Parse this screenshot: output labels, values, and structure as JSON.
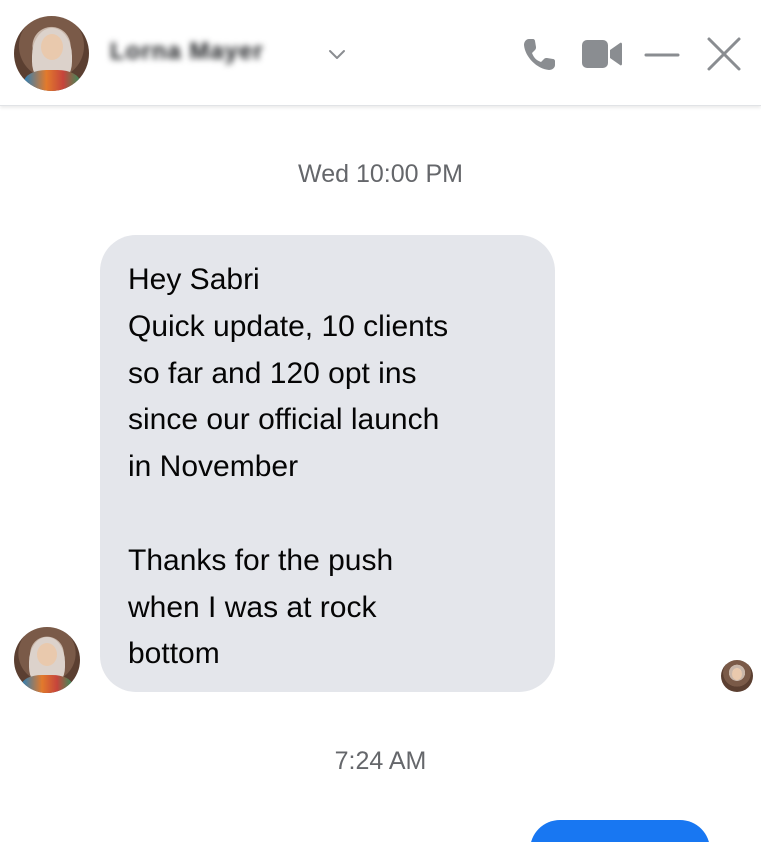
{
  "header": {
    "contact_name": "Lorna Mayer",
    "icons": [
      "phone-icon",
      "video-camera-icon",
      "minimize-icon",
      "close-icon",
      "chevron-down-icon"
    ]
  },
  "messages": {
    "timestamp_1": "Wed 10:00 PM",
    "incoming_text": "Hey Sabri\nQuick update, 10 clients\nso far and 120 opt ins\nsince our official launch\nin November\n\nThanks for the push\nwhen I was at rock\nbottom",
    "timestamp_2": "7:24 AM"
  },
  "colors": {
    "incoming_bubble": "#e4e6eb",
    "outgoing_bubble": "#1877f2",
    "icon_gray": "#8a8d91",
    "timestamp_gray": "#65676b"
  }
}
